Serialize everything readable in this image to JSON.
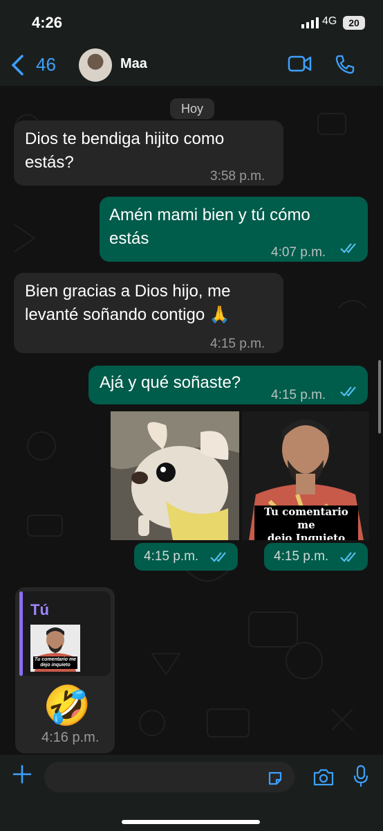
{
  "status": {
    "time": "4:26",
    "network": "4G",
    "battery": "20"
  },
  "header": {
    "back_count": "46",
    "contact_name": "Maa"
  },
  "day_label": "Hoy",
  "messages": [
    {
      "text": "Dios te bendiga hijito como\nestás?",
      "time": "3:58 p.m."
    },
    {
      "text": "Amén mami bien y tú cómo\nestás",
      "time": "4:07 p.m."
    },
    {
      "text": "Bien gracias a Dios hijo, me\nlevanté soñando contigo 🙏",
      "time": "4:15 p.m."
    },
    {
      "text": "Ajá y qué soñaste?",
      "time": "4:15 p.m."
    }
  ],
  "stickers": [
    {
      "caption": "",
      "time": "4:15 p.m."
    },
    {
      "caption": "Tu comentario me\ndejo Inquieto",
      "time": "4:15 p.m."
    }
  ],
  "reply": {
    "author": "Tú",
    "thumb_caption": "Tu comentario me\ndejo inquieto",
    "emoji": "🤣",
    "time": "4:16 p.m."
  },
  "colors": {
    "outgoing": "#005c4b",
    "incoming": "#262626",
    "accent": "#3ea0ff",
    "ticks": "#53bdeb"
  }
}
